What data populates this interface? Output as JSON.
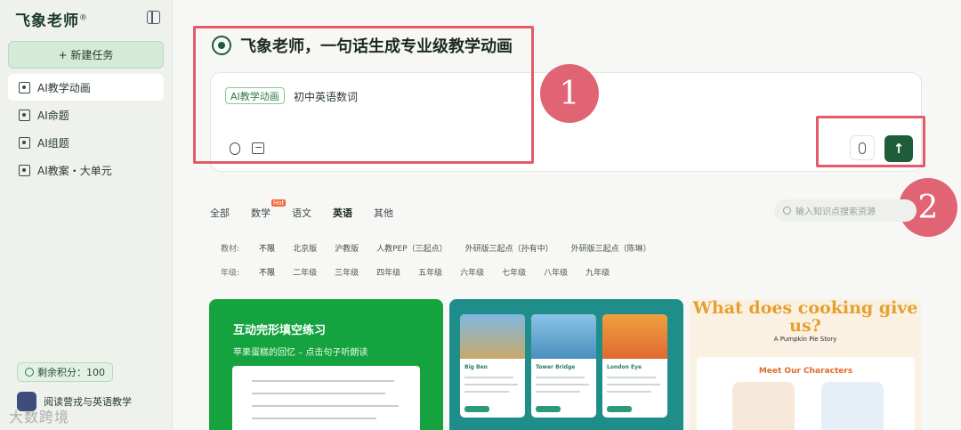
{
  "sidebar": {
    "brand": "飞象老师",
    "brand_mark": "®",
    "new_task_label": "+ 新建任务",
    "items": [
      {
        "label": "AI教学动画"
      },
      {
        "label": "AI命题"
      },
      {
        "label": "AI组题"
      },
      {
        "label": "AI教案・大单元"
      }
    ],
    "credits": "剩余积分：100",
    "user_name": "阅读营戎与英语教学",
    "watermark": "大数跨境"
  },
  "main": {
    "headline": "飞象老师，一句话生成专业级教学动画",
    "input": {
      "tag": "AI教学动画",
      "text": "初中英语数词"
    },
    "annotations": [
      "1",
      "2"
    ],
    "tabs": [
      {
        "label": "全部"
      },
      {
        "label": "数学",
        "badge": "Hot"
      },
      {
        "label": "语文"
      },
      {
        "label": "英语"
      },
      {
        "label": "其他"
      }
    ],
    "search_placeholder": "输入知识点搜索资源",
    "textbook": {
      "label": "教材:",
      "options": [
        "不限",
        "北京版",
        "沪教版",
        "人教PEP（三起点）",
        "外研版三起点（孙有中）",
        "外研版三起点（陈琳）"
      ]
    },
    "grade": {
      "label": "年级:",
      "options": [
        "不限",
        "二年级",
        "三年级",
        "四年级",
        "五年级",
        "六年级",
        "七年级",
        "八年级",
        "九年级"
      ]
    },
    "cards": {
      "card1_title": "互动完形填空练习",
      "card1_sub": "苹果蛋糕的回忆 – 点击句子听朗读",
      "card2_items": [
        "Big Ben",
        "Tower Bridge",
        "London Eye"
      ],
      "card3_title": "What does cooking give us?",
      "card3_sub": "A Pumpkin Pie Story",
      "card3_panel": "Meet Our Characters"
    }
  },
  "colors": {
    "accent": "#1e5c3a",
    "annotation": "#e35a6a",
    "card1": "#14a33f",
    "card2": "#1f8e8a"
  }
}
